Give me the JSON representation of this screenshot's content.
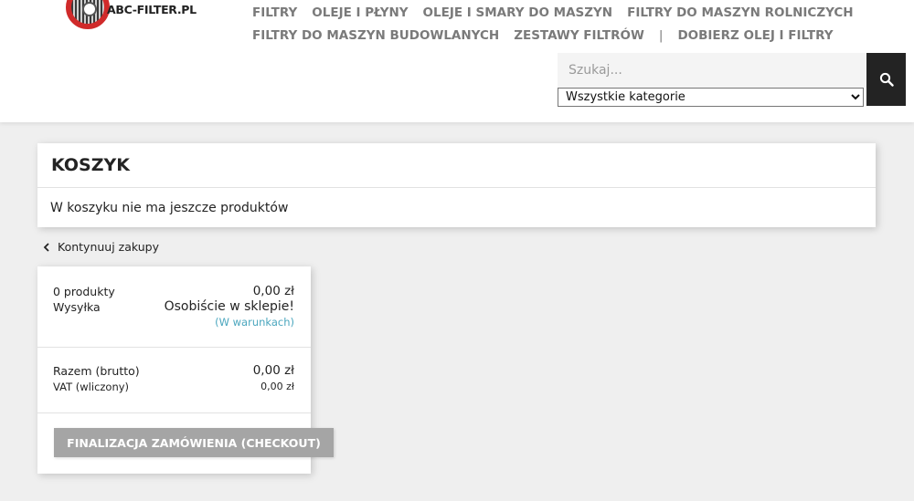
{
  "header": {
    "logo_text": "ABC-FILTER.PL",
    "nav_row1": [
      "FILTRY",
      "OLEJE I PŁYNY",
      "OLEJE I SMARY DO MASZYN",
      "FILTRY DO MASZYN ROLNICZYCH"
    ],
    "nav_row2": [
      "FILTRY DO MASZYN BUDOWLANYCH",
      "ZESTAWY FILTRÓW"
    ],
    "nav_separator": "|",
    "nav_row2_last": "DOBIERZ OLEJ I FILTRY",
    "search": {
      "placeholder": "Szukaj...",
      "value": "",
      "category_selected": "Wszystkie kategorie",
      "icon": "search-icon"
    }
  },
  "cart": {
    "title": "KOSZYK",
    "empty_message": "W koszyku nie ma jeszcze produktów",
    "continue_label": "Kontynuuj zakupy"
  },
  "summary": {
    "products_label": "0 produkty",
    "products_value": "0,00 zł",
    "shipping_label": "Wysyłka",
    "shipping_value": "Osobiście w sklepie!",
    "shipping_conditions": "(W warunkach)",
    "total_label": "Razem (brutto)",
    "total_value": "0,00 zł",
    "vat_label": "VAT (wliczony)",
    "vat_value": "0,00 zł",
    "checkout_label": "FINALIZACJA ZAMÓWIENIA (CHECKOUT)"
  },
  "colors": {
    "nav_text": "#7a7a7a",
    "link": "#4aa6be",
    "checkout_bg": "#a5a5a5",
    "search_button_bg": "#232323",
    "logo_red": "#d02a2a"
  }
}
